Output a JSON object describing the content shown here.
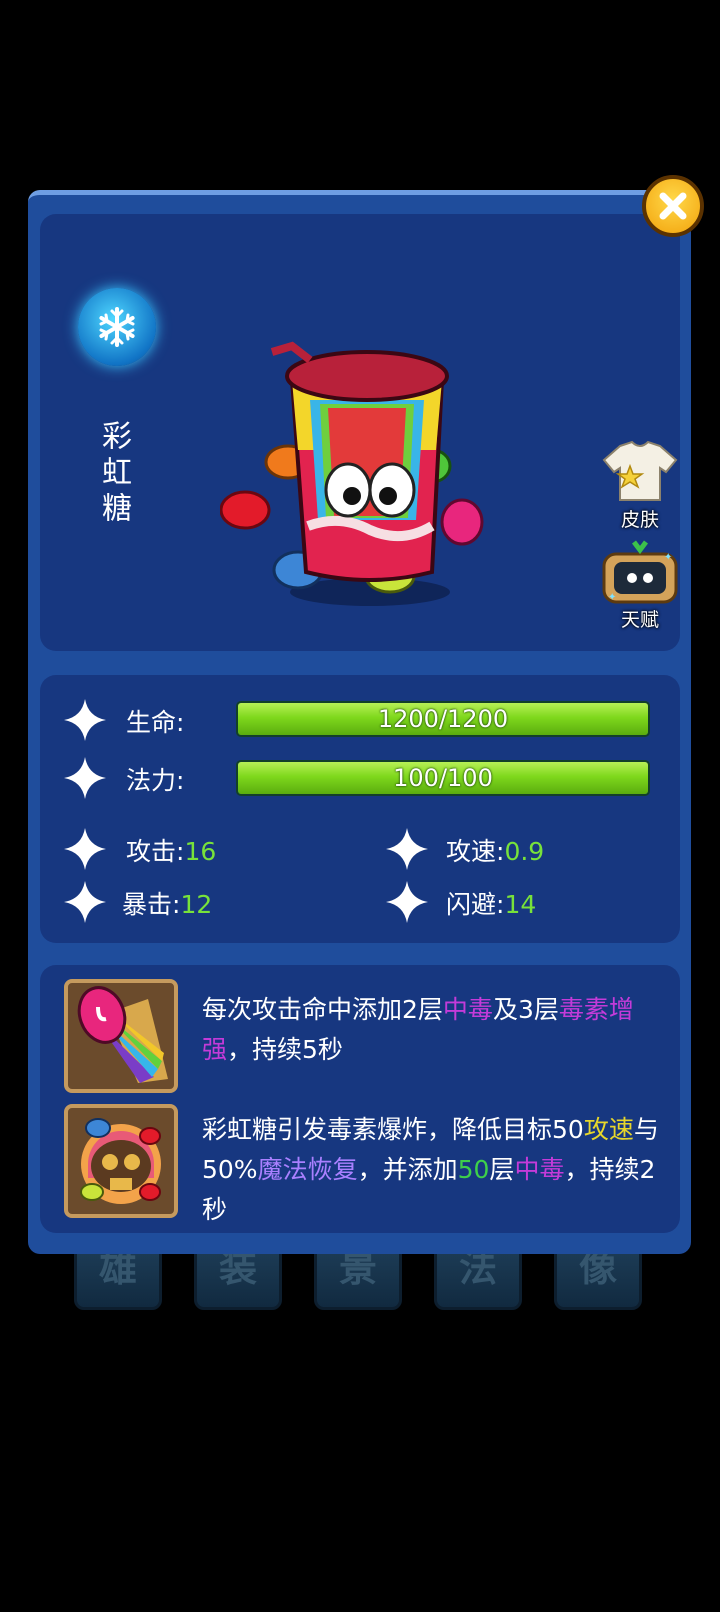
{
  "background_tabs": [
    "雄",
    "装",
    "景",
    "法",
    "像"
  ],
  "hero": {
    "name": "彩虹糖",
    "element_icon": "snowflake-icon"
  },
  "side_buttons": {
    "skin_label": "皮肤",
    "talent_label": "天赋"
  },
  "stats": {
    "hp": {
      "label": "生命:",
      "text": "1200/1200",
      "fill": 1.0
    },
    "mp": {
      "label": "法力:",
      "text": "100/100",
      "fill": 1.0
    },
    "attack": {
      "label": "攻击:",
      "value": "16"
    },
    "attack_speed": {
      "label": "攻速:",
      "value": "0.9"
    },
    "crit": {
      "label": "暴击:",
      "value": "12"
    },
    "dodge": {
      "label": "闪避:",
      "value": "14"
    }
  },
  "skills": [
    {
      "icon": "candy-horn-icon",
      "parts": [
        "每次攻击命中添加2层",
        "中毒",
        "及3层",
        "毒素增强",
        "，持续5秒"
      ]
    },
    {
      "icon": "rainbow-skull-icon",
      "parts": [
        "彩虹糖引发毒素爆炸，降低目标50",
        "攻速",
        "与50%",
        "魔法恢复",
        "，并添加",
        "50",
        "层",
        "中毒",
        "，持续2秒"
      ]
    }
  ],
  "colors": {
    "modal_bg": "#1f4d9c",
    "panel_bg": "#173780",
    "bar_green": "#7fd81c",
    "value_green": "#78e23a",
    "keyword_magenta": "#c43bd9",
    "keyword_yellow": "#e6d62b",
    "keyword_purple": "#a980ff"
  }
}
